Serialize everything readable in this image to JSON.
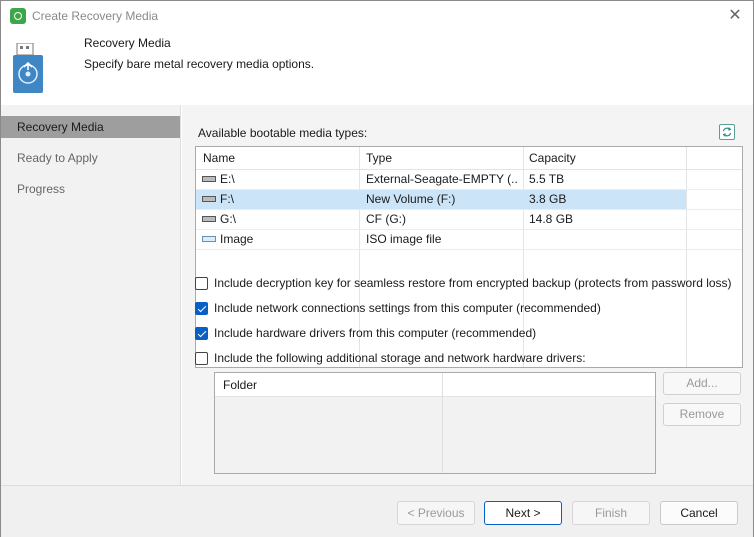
{
  "window": {
    "title": "Create Recovery Media",
    "close_glyph": "✕"
  },
  "header": {
    "title": "Recovery Media",
    "subtitle": "Specify bare metal recovery media options."
  },
  "sidebar": {
    "steps": [
      {
        "label": "Recovery Media",
        "active": true
      },
      {
        "label": "Ready to Apply",
        "active": false
      },
      {
        "label": "Progress",
        "active": false
      }
    ]
  },
  "main": {
    "available_label": "Available bootable media types:",
    "media_table": {
      "columns": [
        "Name",
        "Type",
        "Capacity"
      ],
      "rows": [
        {
          "name": "E:\\",
          "type": "External-Seagate-EMPTY (...",
          "capacity": "5.5 TB",
          "icon": "drive-icon",
          "selected": false
        },
        {
          "name": "F:\\",
          "type": "New Volume (F:)",
          "capacity": "3.8 GB",
          "icon": "drive-icon",
          "selected": true
        },
        {
          "name": "G:\\",
          "type": "CF (G:)",
          "capacity": "14.8 GB",
          "icon": "drive-icon",
          "selected": false
        },
        {
          "name": "Image",
          "type": "ISO image file",
          "capacity": "",
          "icon": "image-icon",
          "selected": false
        }
      ]
    },
    "options": [
      {
        "label": "Include decryption key for seamless restore from encrypted backup (protects from password loss)",
        "checked": false
      },
      {
        "label": "Include network connections settings from this computer (recommended)",
        "checked": true
      },
      {
        "label": "Include hardware drivers from this computer (recommended)",
        "checked": true
      },
      {
        "label": "Include the following additional storage and network hardware drivers:",
        "checked": false
      }
    ],
    "folder_table": {
      "columns": [
        "Folder"
      ]
    },
    "add_label": "Add...",
    "remove_label": "Remove"
  },
  "footer": {
    "previous_label": "< Previous",
    "next_label": "Next >",
    "finish_label": "Finish",
    "cancel_label": "Cancel"
  },
  "colors": {
    "accent": "#0a5fc4",
    "selection": "#cce4f7",
    "active_step": "#9e9e9e"
  }
}
